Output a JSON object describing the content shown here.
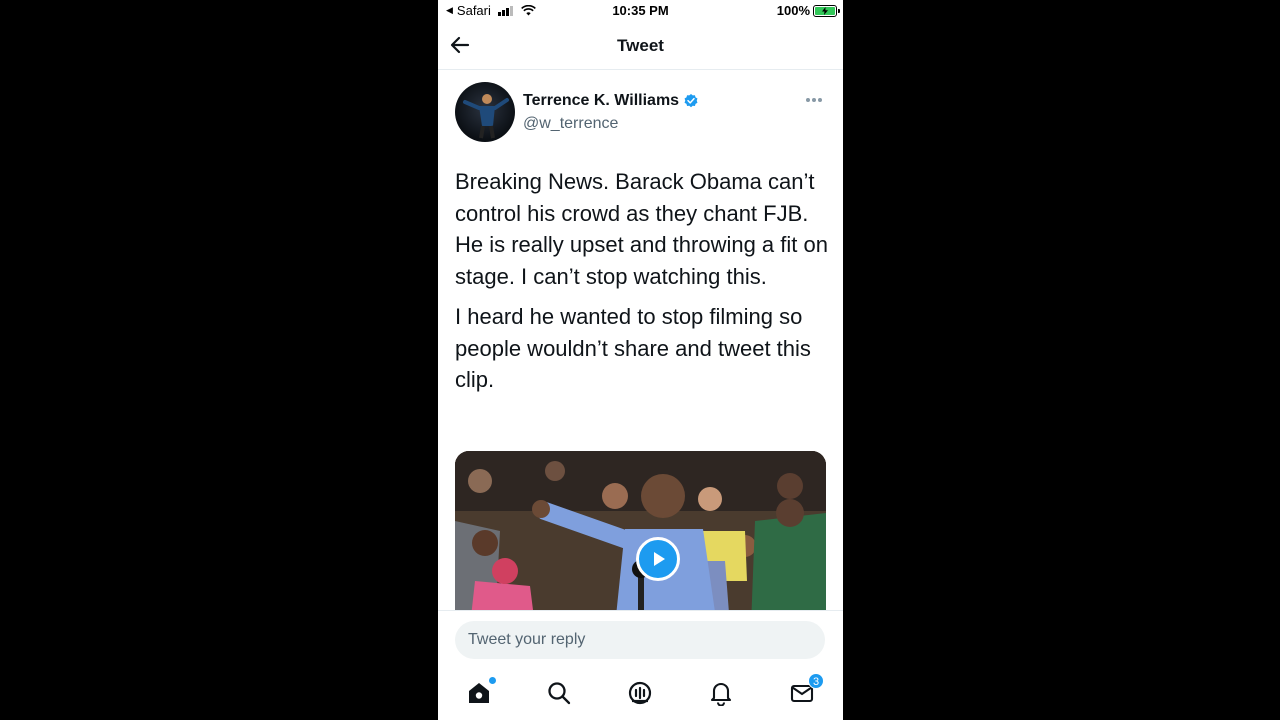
{
  "status_bar": {
    "back_app": "Safari",
    "time": "10:35 PM",
    "battery": "100%"
  },
  "header": {
    "title": "Tweet"
  },
  "tweet": {
    "author_name": "Terrence K. Williams",
    "author_handle": "@w_terrence",
    "paragraphs": [
      "Breaking News. Barack Obama can’t control his crowd as they chant FJB. He is really upset and throwing a fit on stage. I can’t stop watching this.",
      "I heard he wanted to stop filming so people wouldn’t share and tweet this clip."
    ]
  },
  "reply": {
    "placeholder": "Tweet your reply"
  },
  "tabbar": {
    "messages_badge": "3"
  },
  "colors": {
    "accent": "#1d9bf0",
    "text": "#0f1419",
    "secondary": "#536471",
    "battery": "#32c759"
  }
}
